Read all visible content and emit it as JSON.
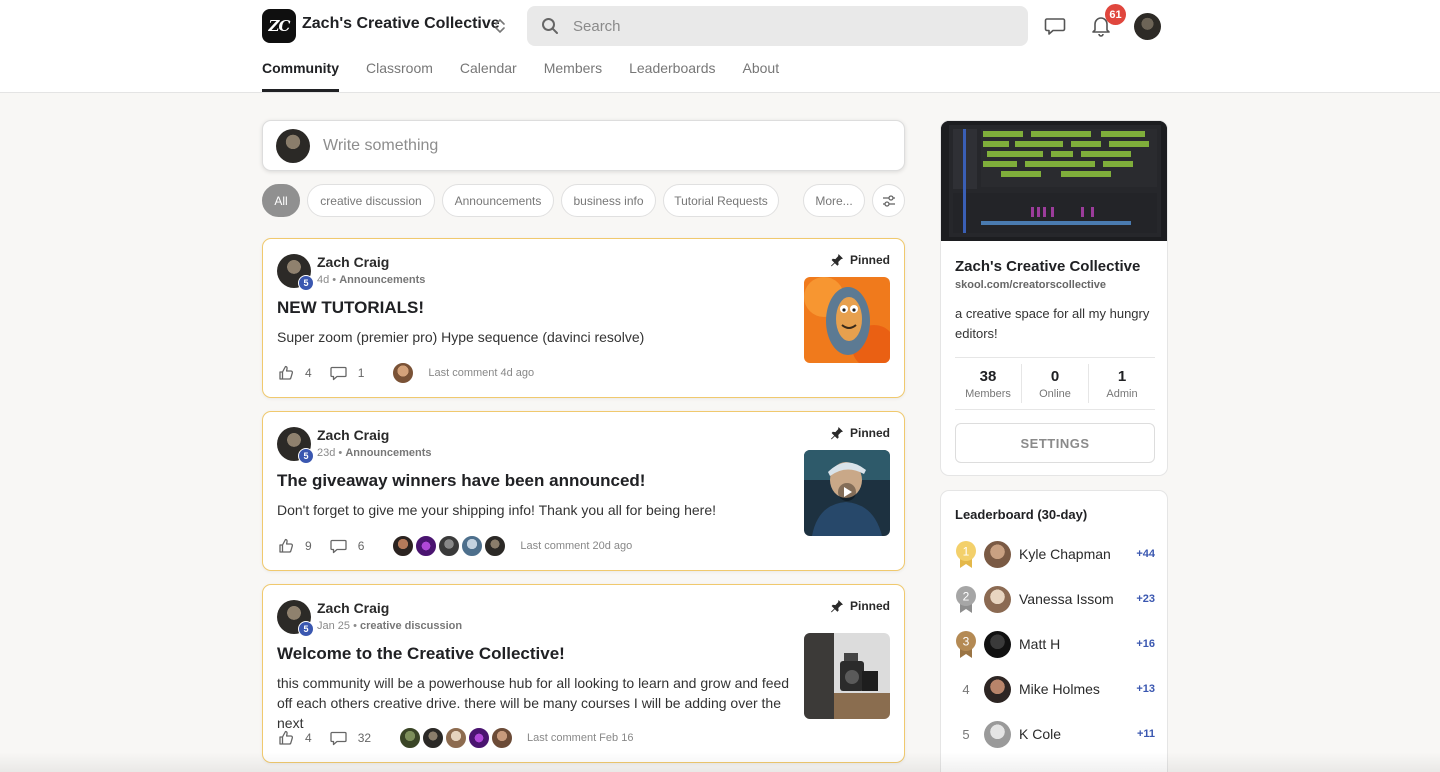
{
  "header": {
    "logo_text": "ZC",
    "community_name": "Zach's Creative Collective",
    "search_placeholder": "Search",
    "notification_count": "61"
  },
  "tabs": [
    "Community",
    "Classroom",
    "Calendar",
    "Members",
    "Leaderboards",
    "About"
  ],
  "active_tab": "Community",
  "composer": {
    "placeholder": "Write something"
  },
  "filters": [
    "All",
    "creative discussion",
    "Announcements",
    "business info",
    "Tutorial Requests",
    "More..."
  ],
  "active_filter": "All",
  "posts": [
    {
      "author": "Zach Craig",
      "level": "5",
      "time": "4d",
      "category": "Announcements",
      "pinned_label": "Pinned",
      "title": "NEW TUTORIALS!",
      "body": "Super zoom (premier pro) Hype sequence (davinci resolve)",
      "likes": "4",
      "comments": "1",
      "last_comment": "Last comment 4d ago"
    },
    {
      "author": "Zach Craig",
      "level": "5",
      "time": "23d",
      "category": "Announcements",
      "pinned_label": "Pinned",
      "title": "The giveaway winners have been announced!",
      "body": "Don't forget to give me your shipping info! Thank you all for being here!",
      "likes": "9",
      "comments": "6",
      "last_comment": "Last comment 20d ago"
    },
    {
      "author": "Zach Craig",
      "level": "5",
      "time": "Jan 25",
      "category": "creative discussion",
      "pinned_label": "Pinned",
      "title": "Welcome to the Creative Collective!",
      "body": "this community will be a powerhouse hub for all looking to learn and grow and feed off each others creative drive. there will be many courses I will be adding over the next",
      "likes": "4",
      "comments": "32",
      "last_comment": "Last comment Feb 16"
    }
  ],
  "group": {
    "name": "Zach's Creative Collective",
    "url": "skool.com/creatorscollective",
    "description": "a creative space for all my hungry editors!",
    "stats": [
      {
        "value": "38",
        "label": "Members"
      },
      {
        "value": "0",
        "label": "Online"
      },
      {
        "value": "1",
        "label": "Admin"
      }
    ],
    "settings_label": "SETTINGS"
  },
  "leaderboard": {
    "title": "Leaderboard (30-day)",
    "entries": [
      {
        "rank": "1",
        "name": "Kyle Chapman",
        "points": "+44"
      },
      {
        "rank": "2",
        "name": "Vanessa Issom",
        "points": "+23"
      },
      {
        "rank": "3",
        "name": "Matt H",
        "points": "+16"
      },
      {
        "rank": "4",
        "name": "Mike Holmes",
        "points": "+13"
      },
      {
        "rank": "5",
        "name": "K Cole",
        "points": "+11"
      }
    ]
  },
  "colors": {
    "accent_blue": "#3a57b0",
    "pinned_border": "#f0c96e",
    "badge_red": "#e0463d",
    "gold": "#f3d06b",
    "silver": "#a6a6a6",
    "bronze": "#b48a54"
  }
}
